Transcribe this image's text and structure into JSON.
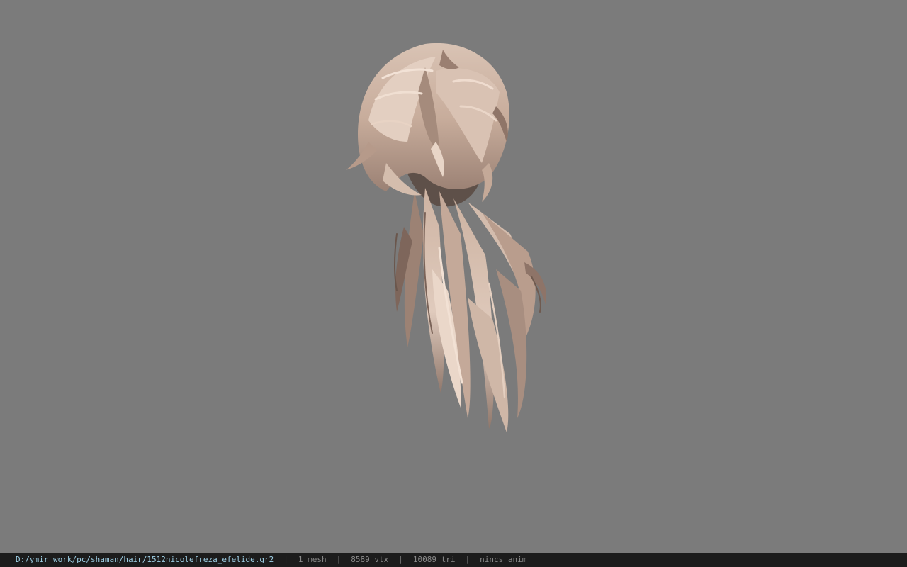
{
  "viewport": {
    "background": "#7b7b7b",
    "model_name": "hair-mesh"
  },
  "statusbar": {
    "file_path": "D:/ymir work/pc/shaman/hair/1512nicolefreza_efelide.gr2",
    "separator": "|",
    "mesh_count": "1 mesh",
    "vertex_count": "8589 vtx",
    "triangle_count": "10089 tri",
    "anim_status": "nincs anim"
  },
  "colors": {
    "hair_light": "#e2cdbf",
    "hair_mid": "#b89b89",
    "hair_dark": "#6c5a50",
    "path_text": "#9fd0e6",
    "status_text": "#8a8a8a",
    "status_bg": "#1c1c1c"
  }
}
